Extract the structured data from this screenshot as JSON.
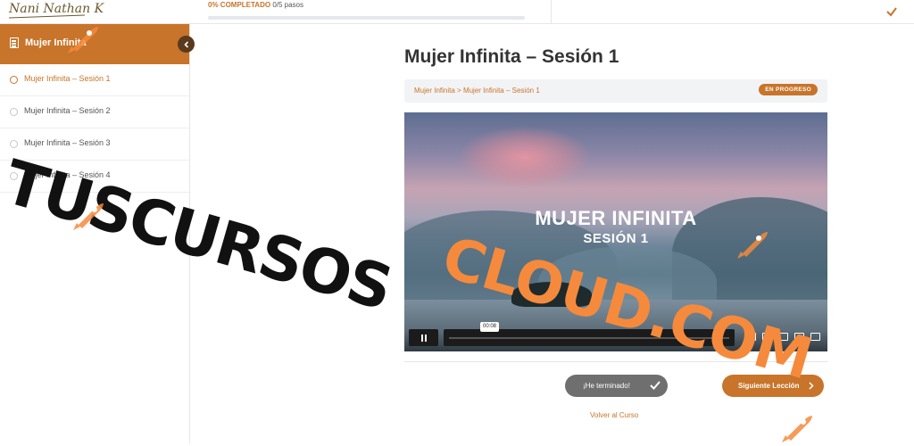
{
  "topbar": {
    "logo_text": "Nani Nathan K",
    "progress_percent_label": "0% COMPLETADO",
    "progress_steps": "0/5 pasos",
    "progress_fraction": 0.0
  },
  "sidebar": {
    "title": "Mujer Infinita",
    "lessons": [
      {
        "label": "Mujer Infinita – Sesión 1",
        "active": true
      },
      {
        "label": "Mujer Infinita – Sesión 2",
        "active": false
      },
      {
        "label": "Mujer Infinita – Sesión 3",
        "active": false
      },
      {
        "label": "Mujer Infinita – Sesión 4",
        "active": false
      }
    ]
  },
  "main": {
    "title": "Mujer Infinita – Sesión 1",
    "breadcrumb": {
      "parent": "Mujer Infinita",
      "separator": ">",
      "current": "Mujer Infinita – Sesión 1"
    },
    "status_badge": "EN PROGRESO",
    "video": {
      "title_line1": "MUJER INFINITA",
      "title_line2": "SESIÓN 1",
      "time_tooltip": "00:08"
    },
    "done_button": "¡He terminado!",
    "next_button": "Siguiente Lección",
    "back_link": "Volver al Curso"
  },
  "watermark": {
    "line1": "TUSCURSOS",
    "line2": "CLOUD.COM"
  },
  "colors": {
    "accent": "#c8742a",
    "done_button": "#6f6f6f",
    "watermark_orange": "#f58a3c"
  }
}
